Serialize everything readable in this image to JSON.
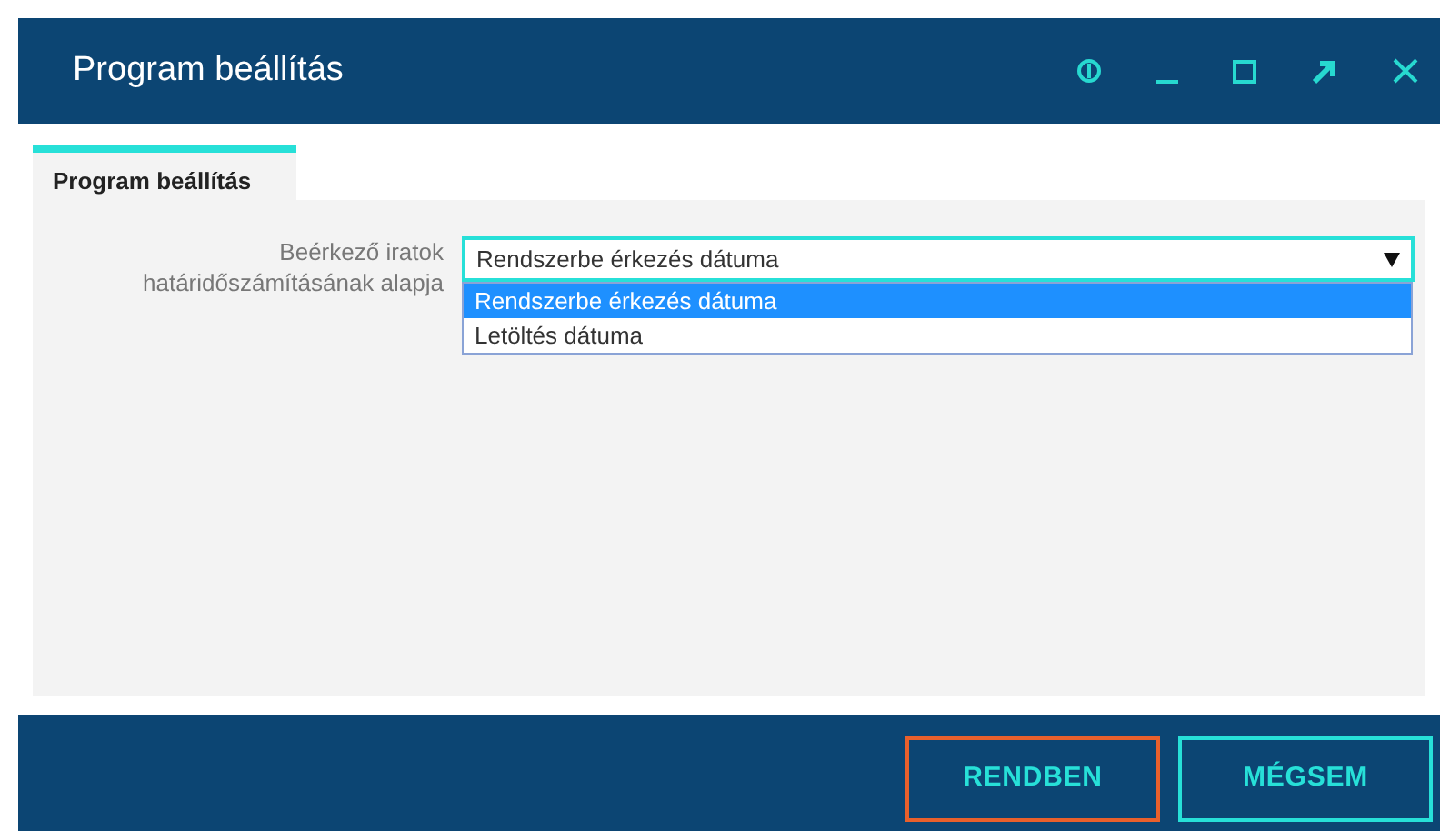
{
  "window": {
    "title": "Program beállítás"
  },
  "tabs": [
    {
      "label": "Program beállítás",
      "selected": true
    }
  ],
  "form": {
    "label": "Beérkező iratok határidőszámításának alapja",
    "value": "Rendszerbe érkezés dátuma",
    "expanded": true,
    "options": [
      {
        "label": "Rendszerbe érkezés dátuma",
        "selected": true
      },
      {
        "label": "Letöltés dátuma",
        "selected": false
      }
    ]
  },
  "buttons": [
    {
      "label": "RENDBEN",
      "focused": true
    },
    {
      "label": "MÉGSEM",
      "focused": false
    }
  ]
}
